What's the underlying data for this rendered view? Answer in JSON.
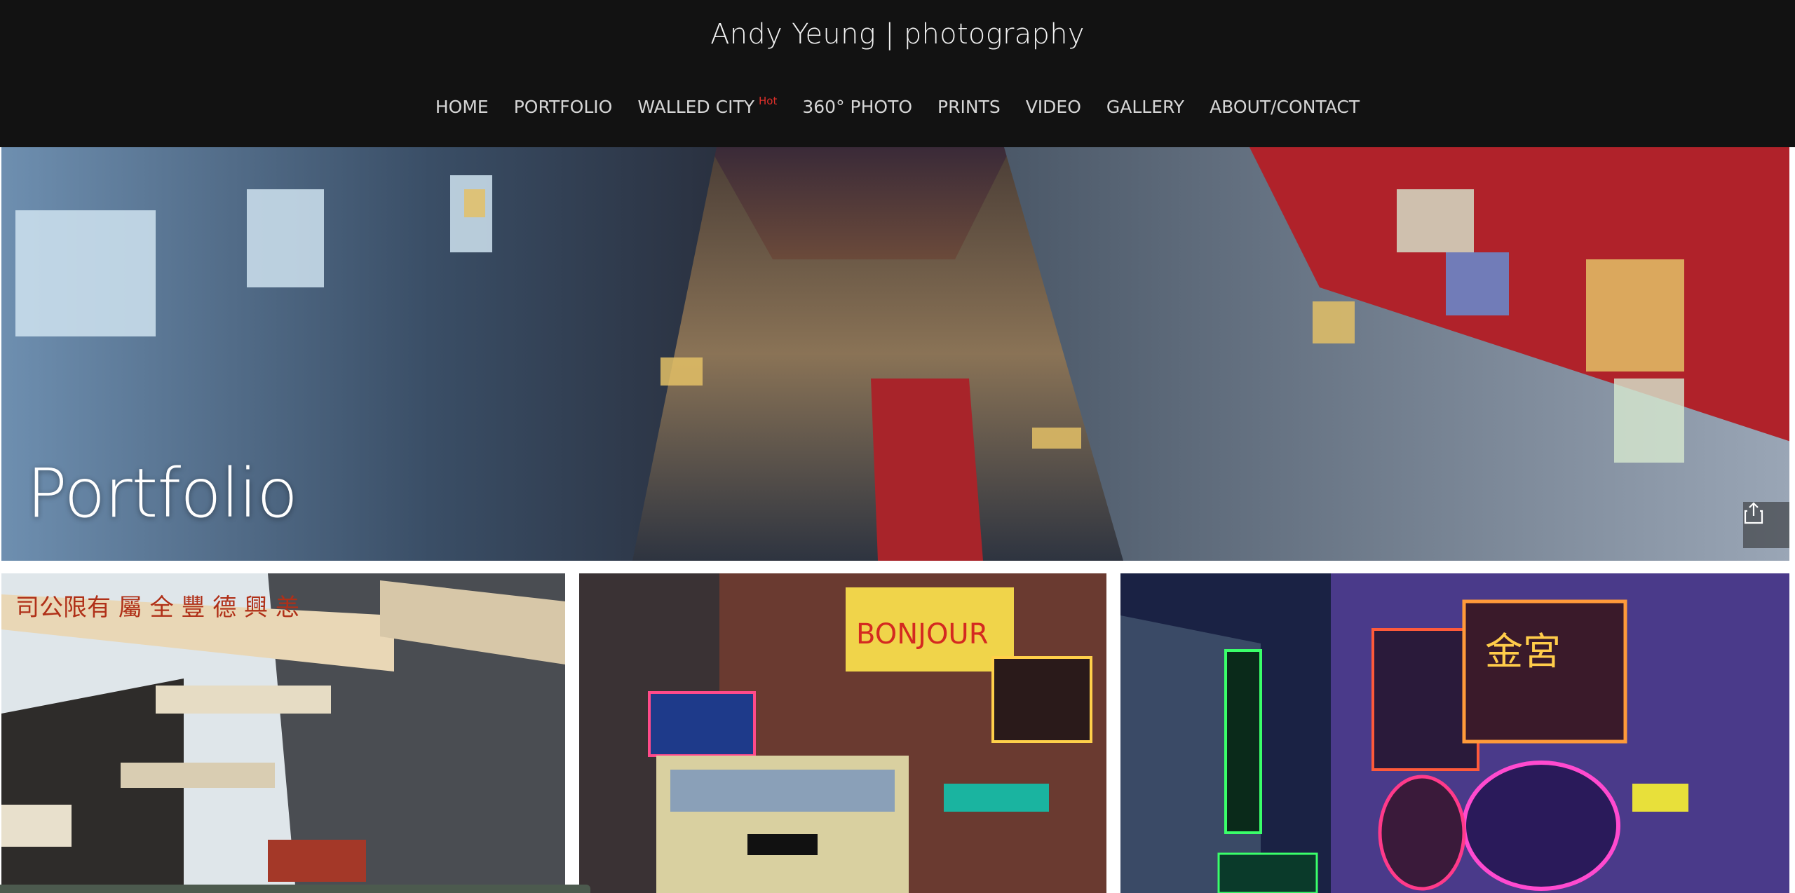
{
  "site": {
    "title": "Andy Yeung | photography"
  },
  "nav": {
    "items": [
      {
        "label": "HOME"
      },
      {
        "label": "PORTFOLIO"
      },
      {
        "label": "WALLED CITY",
        "badge": "Hot"
      },
      {
        "label": "360° PHOTO"
      },
      {
        "label": "PRINTS"
      },
      {
        "label": "VIDEO"
      },
      {
        "label": "GALLERY"
      },
      {
        "label": "ABOUT/CONTACT"
      }
    ]
  },
  "hero": {
    "title": "Portfolio",
    "share_icon": "share-icon"
  },
  "colors": {
    "header_bg": "#121212",
    "nav_text": "#d6d6d6",
    "hot_badge": "#e0302a"
  },
  "gallery": {
    "tiles": [
      {
        "icon": "photo-street-signs"
      },
      {
        "icon": "photo-neon-bus"
      },
      {
        "icon": "photo-neon-alley"
      }
    ]
  }
}
